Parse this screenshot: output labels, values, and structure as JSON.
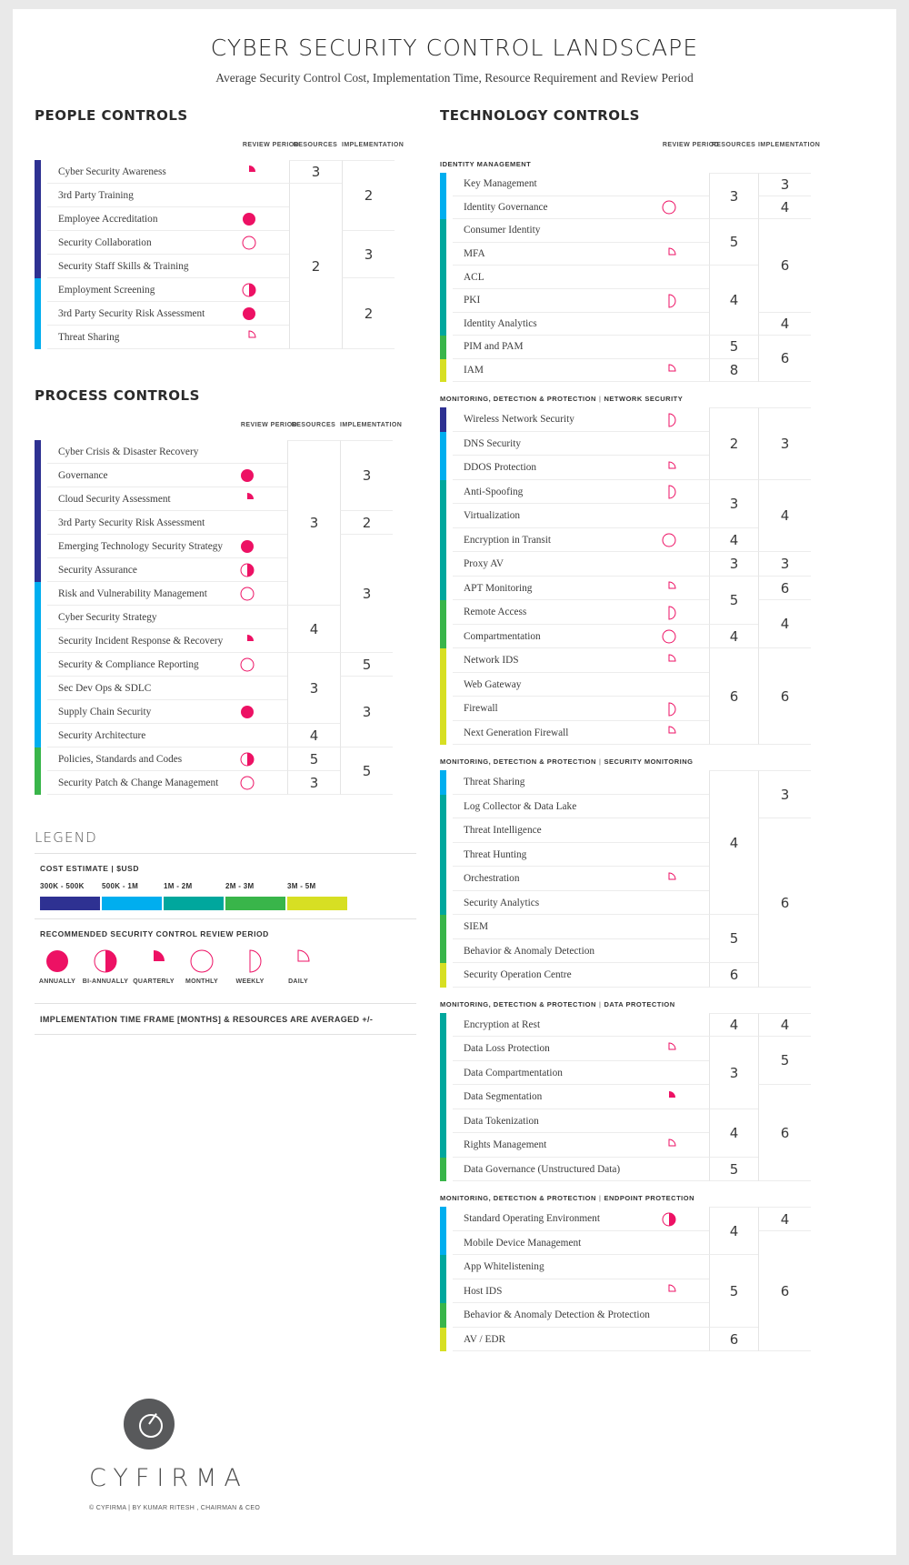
{
  "header": {
    "title": "CYBER SECURITY CONTROL LANDSCAPE",
    "subtitle": "Average Security Control Cost, Implementation Time, Resource Requirement and Review Period"
  },
  "columns": {
    "review_period": "REVIEW PERIOD",
    "resources": "RESOURCES",
    "implementation": "IMPLEMENTATION"
  },
  "cost_colors": {
    "band1": "#2e3192",
    "band2": "#00aeef",
    "band3": "#00a79d",
    "band4": "#39b54a",
    "band5": "#d7df23",
    "accent_pink": "#ed1164"
  },
  "sections": {
    "people": {
      "title": "PEOPLE CONTROLS",
      "rows": [
        {
          "label": "Cyber Security Awareness",
          "cost": "band1",
          "review": "quarterly"
        },
        {
          "label": "3rd Party Training",
          "cost": "band1",
          "review": ""
        },
        {
          "label": "Employee Accreditation",
          "cost": "band1",
          "review": "annually"
        },
        {
          "label": "Security Collaboration",
          "cost": "band1",
          "review": "monthly"
        },
        {
          "label": "Security Staff Skills & Training",
          "cost": "band1",
          "review": ""
        },
        {
          "label": "Employment Screening",
          "cost": "band2",
          "review": "bi-annually"
        },
        {
          "label": "3rd Party Security Risk Assessment",
          "cost": "band2",
          "review": "annually"
        },
        {
          "label": "Threat Sharing",
          "cost": "band2",
          "review": "daily"
        }
      ],
      "resources": [
        {
          "value": "3",
          "span": 1
        },
        {
          "value": "2",
          "span": 7
        }
      ],
      "implementation": [
        {
          "value": "2",
          "span": 3
        },
        {
          "value": "3",
          "span": 2
        },
        {
          "value": "2",
          "span": 3
        }
      ]
    },
    "process": {
      "title": "PROCESS CONTROLS",
      "rows": [
        {
          "label": "Cyber Crisis & Disaster Recovery",
          "cost": "band1",
          "review": ""
        },
        {
          "label": "Governance",
          "cost": "band1",
          "review": "annually"
        },
        {
          "label": "Cloud Security Assessment",
          "cost": "band1",
          "review": "quarterly"
        },
        {
          "label": "3rd Party Security Risk Assessment",
          "cost": "band1",
          "review": ""
        },
        {
          "label": "Emerging Technology Security Strategy",
          "cost": "band1",
          "review": "annually"
        },
        {
          "label": "Security Assurance",
          "cost": "band1",
          "review": "bi-annually"
        },
        {
          "label": "Risk and Vulnerability Management",
          "cost": "band2",
          "review": "monthly"
        },
        {
          "label": "Cyber Security Strategy",
          "cost": "band2",
          "review": ""
        },
        {
          "label": "Security Incident Response & Recovery",
          "cost": "band2",
          "review": "quarterly"
        },
        {
          "label": "Security & Compliance Reporting",
          "cost": "band2",
          "review": "monthly"
        },
        {
          "label": "Sec Dev Ops & SDLC",
          "cost": "band2",
          "review": ""
        },
        {
          "label": "Supply Chain Security",
          "cost": "band2",
          "review": "annually"
        },
        {
          "label": "Security Architecture",
          "cost": "band2",
          "review": ""
        },
        {
          "label": "Policies, Standards and Codes",
          "cost": "band4",
          "review": "bi-annually"
        },
        {
          "label": "Security Patch & Change Management",
          "cost": "band4",
          "review": "monthly"
        }
      ],
      "resources": [
        {
          "value": "3",
          "span": 7
        },
        {
          "value": "4",
          "span": 2
        },
        {
          "value": "3",
          "span": 3
        },
        {
          "value": "4",
          "span": 1
        },
        {
          "value": "5",
          "span": 1
        },
        {
          "value": "3",
          "span": 1
        }
      ],
      "implementation": [
        {
          "value": "3",
          "span": 3
        },
        {
          "value": "2",
          "span": 1
        },
        {
          "value": "3",
          "span": 5
        },
        {
          "value": "5",
          "span": 1
        },
        {
          "value": "3",
          "span": 3
        },
        {
          "value": "5",
          "span": 2
        }
      ]
    },
    "identity": {
      "group": "IDENTITY MANAGEMENT",
      "rows": [
        {
          "label": "Key Management",
          "cost": "band2",
          "review": ""
        },
        {
          "label": "Identity Governance",
          "cost": "band2",
          "review": "monthly"
        },
        {
          "label": "Consumer Identity",
          "cost": "band3",
          "review": ""
        },
        {
          "label": "MFA",
          "cost": "band3",
          "review": "daily"
        },
        {
          "label": "ACL",
          "cost": "band3",
          "review": ""
        },
        {
          "label": "PKI",
          "cost": "band3",
          "review": "weekly"
        },
        {
          "label": "Identity Analytics",
          "cost": "band3",
          "review": ""
        },
        {
          "label": "PIM and PAM",
          "cost": "band4",
          "review": ""
        },
        {
          "label": "IAM",
          "cost": "band5",
          "review": "daily"
        }
      ],
      "resources": [
        {
          "value": "3",
          "span": 2
        },
        {
          "value": "5",
          "span": 2
        },
        {
          "value": "4",
          "span": 3
        },
        {
          "value": "5",
          "span": 1
        },
        {
          "value": "8",
          "span": 1
        }
      ],
      "implementation": [
        {
          "value": "3",
          "span": 1
        },
        {
          "value": "4",
          "span": 1
        },
        {
          "value": "6",
          "span": 4
        },
        {
          "value": "4",
          "span": 1
        },
        {
          "value": "6",
          "span": 2
        }
      ]
    },
    "network": {
      "group_main": "MONITORING, DETECTION & PROTECTION",
      "group_sub": "NETWORK SECURITY",
      "rows": [
        {
          "label": "Wireless Network Security",
          "cost": "band1",
          "review": "weekly"
        },
        {
          "label": "DNS Security",
          "cost": "band2",
          "review": ""
        },
        {
          "label": "DDOS Protection",
          "cost": "band2",
          "review": "daily"
        },
        {
          "label": "Anti-Spoofing",
          "cost": "band3",
          "review": "weekly"
        },
        {
          "label": "Virtualization",
          "cost": "band3",
          "review": ""
        },
        {
          "label": "Encryption in Transit",
          "cost": "band3",
          "review": "monthly"
        },
        {
          "label": "Proxy AV",
          "cost": "band3",
          "review": ""
        },
        {
          "label": "APT Monitoring",
          "cost": "band3",
          "review": "daily"
        },
        {
          "label": "Remote Access",
          "cost": "band4",
          "review": "weekly"
        },
        {
          "label": "Compartmentation",
          "cost": "band4",
          "review": "monthly"
        },
        {
          "label": "Network IDS",
          "cost": "band5",
          "review": "daily"
        },
        {
          "label": "Web Gateway",
          "cost": "band5",
          "review": ""
        },
        {
          "label": "Firewall",
          "cost": "band5",
          "review": "weekly"
        },
        {
          "label": "Next Generation Firewall",
          "cost": "band5",
          "review": "daily"
        }
      ],
      "resources": [
        {
          "value": "2",
          "span": 3
        },
        {
          "value": "3",
          "span": 2
        },
        {
          "value": "4",
          "span": 1
        },
        {
          "value": "3",
          "span": 1
        },
        {
          "value": "5",
          "span": 2
        },
        {
          "value": "4",
          "span": 1
        },
        {
          "value": "6",
          "span": 4
        }
      ],
      "implementation": [
        {
          "value": "3",
          "span": 3
        },
        {
          "value": "4",
          "span": 3
        },
        {
          "value": "3",
          "span": 1
        },
        {
          "value": "6",
          "span": 1
        },
        {
          "value": "4",
          "span": 2
        },
        {
          "value": "6",
          "span": 4
        }
      ]
    },
    "monitoring": {
      "group_main": "MONITORING, DETECTION & PROTECTION",
      "group_sub": "SECURITY MONITORING",
      "rows": [
        {
          "label": "Threat Sharing",
          "cost": "band2",
          "review": ""
        },
        {
          "label": "Log Collector & Data Lake",
          "cost": "band3",
          "review": ""
        },
        {
          "label": "Threat Intelligence",
          "cost": "band3",
          "review": ""
        },
        {
          "label": "Threat Hunting",
          "cost": "band3",
          "review": ""
        },
        {
          "label": "Orchestration",
          "cost": "band3",
          "review": "daily"
        },
        {
          "label": "Security Analytics",
          "cost": "band3",
          "review": ""
        },
        {
          "label": "SIEM",
          "cost": "band4",
          "review": ""
        },
        {
          "label": "Behavior & Anomaly Detection",
          "cost": "band4",
          "review": ""
        },
        {
          "label": "Security Operation Centre",
          "cost": "band5",
          "review": ""
        }
      ],
      "resources": [
        {
          "value": "4",
          "span": 6
        },
        {
          "value": "5",
          "span": 2
        },
        {
          "value": "6",
          "span": 1
        }
      ],
      "implementation": [
        {
          "value": "3",
          "span": 2
        },
        {
          "value": "6",
          "span": 7
        }
      ]
    },
    "data": {
      "group_main": "MONITORING, DETECTION & PROTECTION",
      "group_sub": "DATA PROTECTION",
      "rows": [
        {
          "label": "Encryption at Rest",
          "cost": "band3",
          "review": ""
        },
        {
          "label": "Data Loss Protection",
          "cost": "band3",
          "review": "daily"
        },
        {
          "label": "Data Compartmentation",
          "cost": "band3",
          "review": ""
        },
        {
          "label": "Data Segmentation",
          "cost": "band3",
          "review": "quarterly"
        },
        {
          "label": "Data Tokenization",
          "cost": "band3",
          "review": ""
        },
        {
          "label": "Rights Management",
          "cost": "band3",
          "review": "daily"
        },
        {
          "label": "Data Governance (Unstructured Data)",
          "cost": "band4",
          "review": ""
        }
      ],
      "resources": [
        {
          "value": "4",
          "span": 1
        },
        {
          "value": "3",
          "span": 3
        },
        {
          "value": "4",
          "span": 2
        },
        {
          "value": "5",
          "span": 1
        }
      ],
      "implementation": [
        {
          "value": "4",
          "span": 1
        },
        {
          "value": "5",
          "span": 2
        },
        {
          "value": "6",
          "span": 4
        }
      ]
    },
    "endpoint": {
      "group_main": "MONITORING, DETECTION & PROTECTION",
      "group_sub": "ENDPOINT PROTECTION",
      "rows": [
        {
          "label": "Standard Operating Environment",
          "cost": "band2",
          "review": "bi-annually"
        },
        {
          "label": "Mobile Device Management",
          "cost": "band2",
          "review": ""
        },
        {
          "label": "App Whitelistening",
          "cost": "band3",
          "review": ""
        },
        {
          "label": "Host IDS",
          "cost": "band3",
          "review": "daily"
        },
        {
          "label": "Behavior & Anomaly Detection & Protection",
          "cost": "band4",
          "review": ""
        },
        {
          "label": "AV / EDR",
          "cost": "band5",
          "review": ""
        }
      ],
      "resources": [
        {
          "value": "4",
          "span": 2
        },
        {
          "value": "5",
          "span": 3
        },
        {
          "value": "6",
          "span": 1
        }
      ],
      "implementation": [
        {
          "value": "4",
          "span": 1
        },
        {
          "value": "6",
          "span": 5
        }
      ]
    },
    "technology_title": "TECHNOLOGY CONTROLS"
  },
  "legend": {
    "title": "LEGEND",
    "cost_caption": "COST ESTIMATE | $USD",
    "cost_ranges": [
      "300K - 500K",
      "500K - 1M",
      "1M - 2M",
      "2M - 3M",
      "3M - 5M"
    ],
    "review_caption": "RECOMMENDED SECURITY CONTROL REVIEW PERIOD",
    "review_items": [
      {
        "label": "ANNUALLY",
        "glyph": "annually"
      },
      {
        "label": "BI-ANNUALLY",
        "glyph": "bi-annually"
      },
      {
        "label": "QUARTERLY",
        "glyph": "quarterly"
      },
      {
        "label": "MONTHLY",
        "glyph": "monthly"
      },
      {
        "label": "WEEKLY",
        "glyph": "weekly"
      },
      {
        "label": "DAILY",
        "glyph": "daily"
      }
    ],
    "note": "IMPLEMENTATION TIME FRAME [MONTHS] & RESOURCES ARE AVERAGED +/-"
  },
  "footer": {
    "brand": "CYFIRMA",
    "copyright": "© CYFIRMA | BY KUMAR RITESH , CHAIRMAN & CEO"
  }
}
